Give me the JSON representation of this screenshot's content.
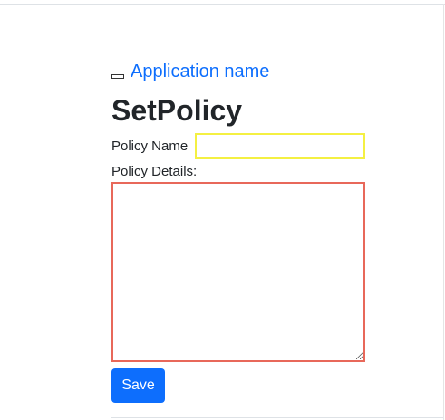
{
  "navbar": {
    "brand": "Application name",
    "toggle_icon": "hamburger-icon"
  },
  "page": {
    "title": "SetPolicy"
  },
  "form": {
    "policy_name_label": "Policy Name",
    "policy_name_value": "",
    "policy_details_label": "Policy Details:",
    "policy_details_value": "",
    "save_label": "Save"
  },
  "colors": {
    "accent": "#0d6efd",
    "name_field_border": "#f4f042",
    "details_field_border": "#e8685a"
  }
}
